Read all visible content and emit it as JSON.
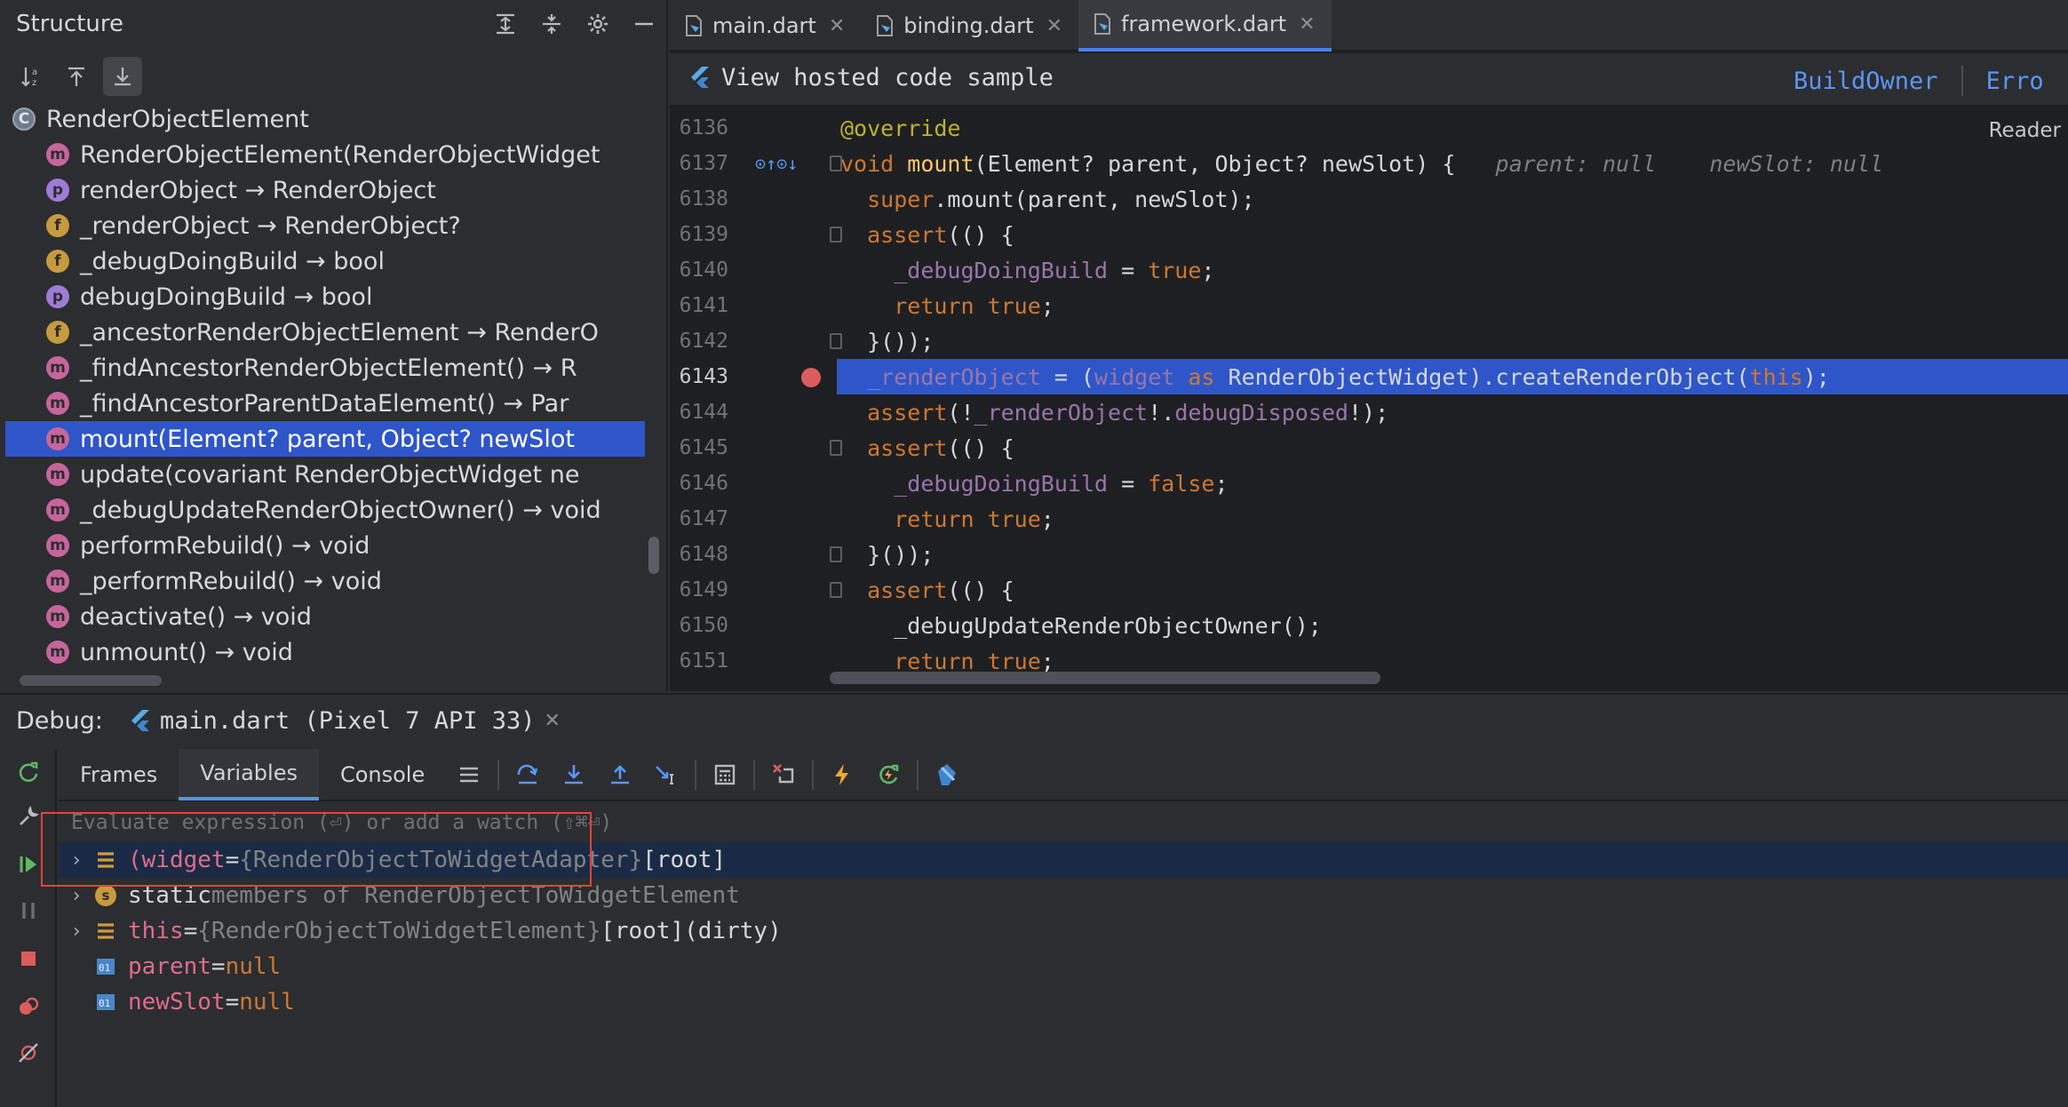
{
  "structure": {
    "title": "Structure",
    "items": [
      {
        "badge": "C",
        "label": "RenderObjectElement"
      },
      {
        "badge": "m",
        "label": "RenderObjectElement(RenderObjectWidget"
      },
      {
        "badge": "p",
        "label": "renderObject → RenderObject"
      },
      {
        "badge": "f",
        "label": "_renderObject → RenderObject?"
      },
      {
        "badge": "f",
        "label": "_debugDoingBuild → bool"
      },
      {
        "badge": "p",
        "label": "debugDoingBuild → bool"
      },
      {
        "badge": "f",
        "label": "_ancestorRenderObjectElement → RenderO"
      },
      {
        "badge": "m",
        "label": "_findAncestorRenderObjectElement() → R"
      },
      {
        "badge": "m",
        "label": "_findAncestorParentDataElement() → Par"
      },
      {
        "badge": "m",
        "label": "mount(Element? parent, Object? newSlot"
      },
      {
        "badge": "m",
        "label": "update(covariant RenderObjectWidget ne"
      },
      {
        "badge": "m",
        "label": "_debugUpdateRenderObjectOwner() → void"
      },
      {
        "badge": "m",
        "label": "performRebuild() → void"
      },
      {
        "badge": "m",
        "label": "_performRebuild() → void"
      },
      {
        "badge": "m",
        "label": "deactivate() → void"
      },
      {
        "badge": "m",
        "label": "unmount() → void"
      }
    ]
  },
  "editor": {
    "tabs": [
      {
        "label": "main.dart"
      },
      {
        "label": "binding.dart"
      },
      {
        "label": "framework.dart"
      }
    ],
    "sample_label": "View hosted code sample",
    "links": [
      "BuildOwner",
      "Erro"
    ],
    "reader": "Reader",
    "line_numbers": [
      "6136",
      "6137",
      "6138",
      "6139",
      "6140",
      "6141",
      "6142",
      "6143",
      "6144",
      "6145",
      "6146",
      "6147",
      "6148",
      "6149",
      "6150",
      "6151"
    ],
    "hints": {
      "parent": "parent: null",
      "newSlot": "newSlot: null"
    }
  },
  "debug": {
    "label": "Debug:",
    "session": "main.dart (Pixel 7 API 33)",
    "tabs": [
      "Frames",
      "Variables",
      "Console"
    ],
    "eval_placeholder": "Evaluate expression (⏎) or add a watch (⇧⌘⏎)",
    "vars": [
      {
        "name": "(widget",
        "eq": " = ",
        "type": "{RenderObjectToWidgetAdapter}",
        "value": " [root]"
      },
      {
        "name": "static",
        "rest": " members of RenderObjectToWidgetElement"
      },
      {
        "name": "this",
        "eq": " = ",
        "type": "{RenderObjectToWidgetElement}",
        "value": " [root](dirty)"
      },
      {
        "name": "parent",
        "eq": " = ",
        "value": "null"
      },
      {
        "name": "newSlot",
        "eq": " = ",
        "value": "null"
      }
    ]
  },
  "colors": {
    "accent": "#2f56c8",
    "breakpoint": "#db5c5c",
    "link": "#5b96f5",
    "highlight_box": "#e0443a"
  }
}
